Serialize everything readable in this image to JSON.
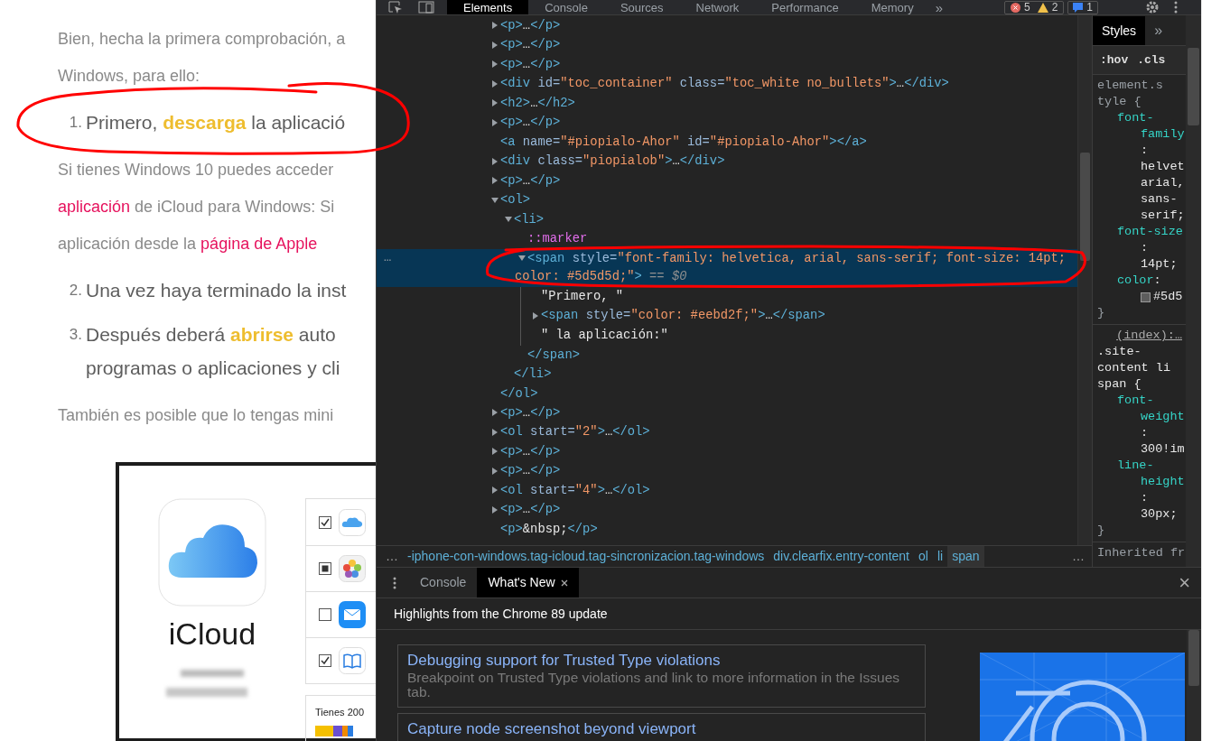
{
  "article": [
    {
      "kind": "paragraph",
      "lines": [
        [
          {
            "text": "Bien, hecha la primera comprobación, a",
            "kind": "plain"
          }
        ],
        [
          {
            "text": "Windows, para ello:",
            "kind": "plain"
          }
        ]
      ]
    },
    {
      "kind": "list_item",
      "number": "1.",
      "lines": [
        [
          {
            "text": "Primero, ",
            "kind": "plain"
          },
          {
            "text": "descarga",
            "kind": "highlight"
          },
          {
            "text": " la aplicació",
            "kind": "plain"
          }
        ]
      ]
    },
    {
      "kind": "paragraph",
      "lines": [
        [
          {
            "text": "Si tienes Windows 10 puedes acceder",
            "kind": "plain"
          }
        ],
        [
          {
            "text": "aplicación",
            "kind": "link"
          },
          {
            "text": " de iCloud para Windows: Si",
            "kind": "plain"
          }
        ],
        [
          {
            "text": "aplicación desde la ",
            "kind": "plain"
          },
          {
            "text": "página de Apple",
            "kind": "link"
          }
        ]
      ]
    },
    {
      "kind": "list_item",
      "number": "2.",
      "lines": [
        [
          {
            "text": "Una vez haya terminado la inst",
            "kind": "plain"
          }
        ]
      ]
    },
    {
      "kind": "list_item",
      "number": "3.",
      "lines": [
        [
          {
            "text": "Después deberá ",
            "kind": "plain"
          },
          {
            "text": "abrirse",
            "kind": "highlight"
          },
          {
            "text": " auto",
            "kind": "plain"
          }
        ],
        [
          {
            "text": "programas o aplicaciones y cli",
            "kind": "plain"
          }
        ]
      ]
    },
    {
      "kind": "paragraph",
      "lines": [
        [
          {
            "text": "También es posible que lo tengas mini",
            "kind": "plain"
          }
        ]
      ]
    },
    {
      "kind": "app_screenshot",
      "app_name": "iCloud",
      "services": [
        {
          "checked": true,
          "mixed": false,
          "kind": "cloud"
        },
        {
          "checked": false,
          "mixed": true,
          "kind": "photos"
        },
        {
          "checked": false,
          "mixed": false,
          "kind": "mail"
        },
        {
          "checked": true,
          "mixed": false,
          "kind": "book"
        }
      ],
      "storage_text": "Tienes 200"
    }
  ],
  "annotations": [
    {
      "kind": "ellipse"
    },
    {
      "kind": "ellipse"
    }
  ],
  "devtools": {
    "tabs": [
      {
        "label": "Elements",
        "selected": true
      },
      {
        "label": "Console",
        "selected": false
      },
      {
        "label": "Sources",
        "selected": false
      },
      {
        "label": "Network",
        "selected": false
      },
      {
        "label": "Performance",
        "selected": false
      },
      {
        "label": "Memory",
        "selected": false
      }
    ],
    "more_tabs": "»",
    "errors": "5",
    "warnings": "2",
    "messages": "1",
    "tree": [
      {
        "kind": "element",
        "text": "<p>…</p>",
        "expanded": false,
        "selected": false
      },
      {
        "kind": "element",
        "text": "<p>…</p>",
        "expanded": false,
        "selected": false
      },
      {
        "kind": "element",
        "text": "<p>…</p>",
        "expanded": false,
        "selected": false
      },
      {
        "kind": "element",
        "text": "<div id=\"toc_container\" class=\"toc_white no_bullets\">…</div>",
        "expanded": false,
        "selected": false
      },
      {
        "kind": "element",
        "text": "<h2>…</h2>",
        "expanded": false,
        "selected": false
      },
      {
        "kind": "element",
        "text": "<p>…</p>",
        "expanded": false,
        "selected": false
      },
      {
        "kind": "leaf",
        "text": "<a name=\"#piopialo-Ahor\" id=\"#piopialo-Ahor\"></a>",
        "selected": false
      },
      {
        "kind": "element",
        "text": "<div class=\"piopialob\">…</div>",
        "expanded": false,
        "selected": false
      },
      {
        "kind": "element",
        "text": "<p>…</p>",
        "expanded": false,
        "selected": false
      },
      {
        "kind": "element",
        "text": "<ol>",
        "expanded": true,
        "selected": false,
        "close": "</ol>",
        "children": [
          {
            "kind": "element",
            "text": "<li>",
            "expanded": true,
            "selected": false,
            "close": "</li>",
            "children": [
              {
                "kind": "pseudo",
                "text": "::marker",
                "selected": false
              },
              {
                "kind": "element",
                "text": "<span style=\"font-family: helvetica, arial, sans-serif; font-size: 14pt; color: #5d5d5d;\">",
                "expanded": true,
                "selected": true,
                "gutter": "…",
                "suffix": "== $0",
                "close": "</span>",
                "children": [
                  {
                    "kind": "text",
                    "text": "\"Primero, \"",
                    "selected": false
                  },
                  {
                    "kind": "element",
                    "text": "<span style=\"color: #eebd2f;\">…</span>",
                    "expanded": false,
                    "selected": false
                  },
                  {
                    "kind": "text",
                    "text": "\" la aplicación:\"",
                    "selected": false
                  }
                ]
              }
            ]
          }
        ]
      },
      {
        "kind": "element",
        "text": "<p>…</p>",
        "expanded": false,
        "selected": false
      },
      {
        "kind": "element",
        "text": "<ol start=\"2\">…</ol>",
        "expanded": false,
        "selected": false
      },
      {
        "kind": "element",
        "text": "<p>…</p>",
        "expanded": false,
        "selected": false
      },
      {
        "kind": "element",
        "text": "<p>…</p>",
        "expanded": false,
        "selected": false
      },
      {
        "kind": "element",
        "text": "<ol start=\"4\">…</ol>",
        "expanded": false,
        "selected": false
      },
      {
        "kind": "element",
        "text": "<p>…</p>",
        "expanded": false,
        "selected": false
      },
      {
        "kind": "leaf",
        "text": "<p>&nbsp;</p>",
        "selected": false
      }
    ],
    "breadcrumbs": [
      {
        "label": "…",
        "selected": false
      },
      {
        "label": "-iphone-con-windows.tag-icloud.tag-sincronizacion.tag-windows",
        "selected": false
      },
      {
        "label": "div.clearfix.entry-content",
        "selected": false
      },
      {
        "label": "ol",
        "selected": false
      },
      {
        "label": "li",
        "selected": false
      },
      {
        "label": "span",
        "selected": true
      },
      {
        "label": "…",
        "selected": false
      }
    ],
    "styles": {
      "tabs": [
        {
          "label": "Styles",
          "selected": true
        }
      ],
      "more_tabs": "»",
      "filter_buttons": [
        ":hov",
        ".cls"
      ],
      "rules": [
        {
          "selector": "element.style {",
          "declarations": [
            {
              "name": "font-family",
              "separator": ":",
              "value": "helvet arial, sans-serif;"
            },
            {
              "name": "font-size",
              "separator": ":",
              "value": "14pt;"
            },
            {
              "kind": "color",
              "name": "color",
              "separator": ":",
              "value": "#5d5"
            }
          ],
          "close": "}"
        },
        {
          "source": "(index):…",
          "selector": ".site-content li span {",
          "declarations": [
            {
              "name": "font-weight",
              "separator": ":",
              "value": "300!im"
            },
            {
              "name": "line-height",
              "separator": ":",
              "value": "30px;"
            }
          ],
          "close": "}"
        }
      ],
      "inherited": "Inherited fr"
    },
    "drawer": {
      "tabs": [
        {
          "label": "Console",
          "selected": false,
          "closable": false
        },
        {
          "label": "What's New",
          "selected": true,
          "closable": true
        }
      ],
      "close": "×",
      "heading": "Highlights from the Chrome 89 update",
      "features": [
        {
          "title": "Debugging support for Trusted Type violations",
          "description": "Breakpoint on Trusted Type violations and link to more information in the Issues tab."
        },
        {
          "title": "Capture node screenshot beyond viewport"
        }
      ]
    }
  }
}
